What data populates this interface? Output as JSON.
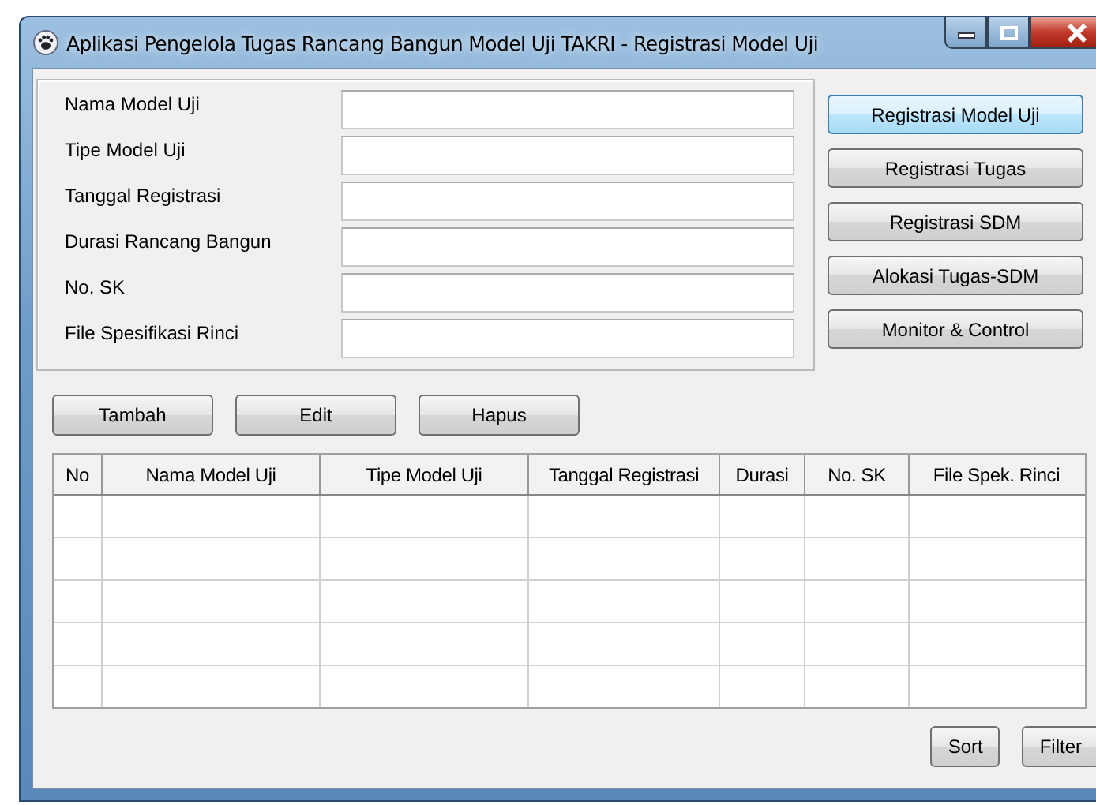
{
  "window": {
    "title": "Aplikasi Pengelola Tugas Rancang Bangun Model Uji TAKRI - Registrasi Model Uji"
  },
  "form": {
    "fields": [
      {
        "label": "Nama Model Uji"
      },
      {
        "label": "Tipe Model Uji"
      },
      {
        "label": "Tanggal Registrasi"
      },
      {
        "label": "Durasi Rancang Bangun"
      },
      {
        "label": "No. SK"
      },
      {
        "label": "File Spesifikasi Rinci"
      }
    ]
  },
  "nav_buttons": [
    {
      "label": "Registrasi Model Uji",
      "selected": true
    },
    {
      "label": "Registrasi Tugas",
      "selected": false
    },
    {
      "label": "Registrasi SDM",
      "selected": false
    },
    {
      "label": "Alokasi Tugas-SDM",
      "selected": false
    },
    {
      "label": "Monitor & Control",
      "selected": false
    }
  ],
  "action_buttons": [
    "Tambah",
    "Edit",
    "Hapus"
  ],
  "table": {
    "columns": [
      "No",
      "Nama Model Uji",
      "Tipe Model Uji",
      "Tanggal Registrasi",
      "Durasi",
      "No. SK",
      "File Spek. Rinci"
    ]
  },
  "bottom_buttons": [
    "Sort",
    "Filter"
  ]
}
